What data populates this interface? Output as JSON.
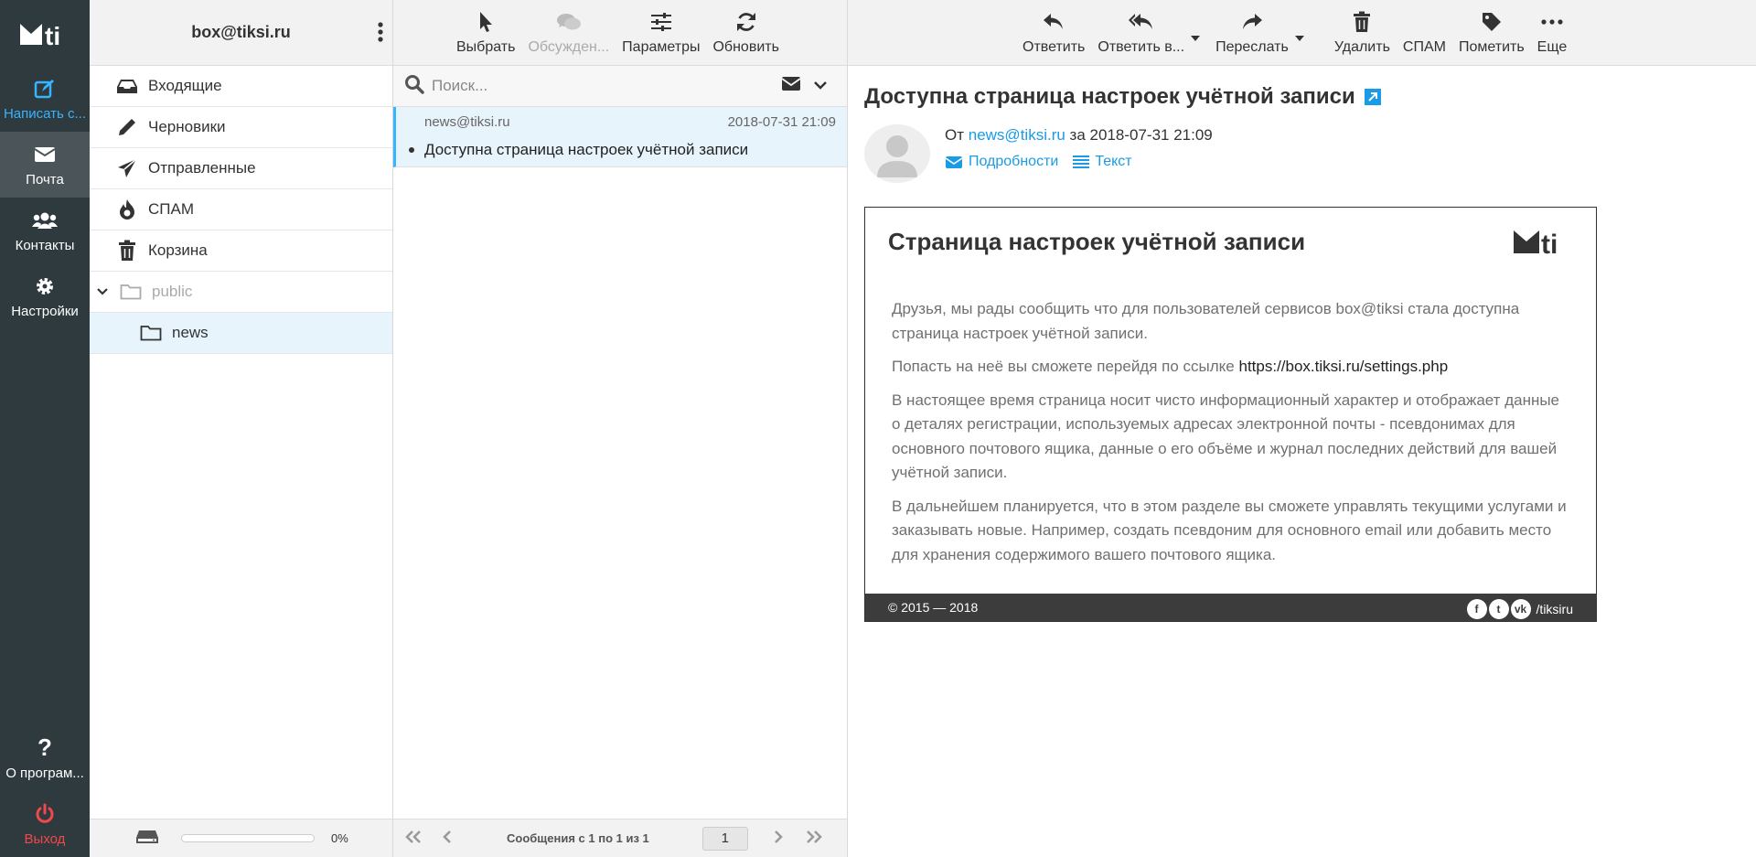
{
  "nav": {
    "items": [
      {
        "label": "Написать с...",
        "icon": "compose-icon"
      },
      {
        "label": "Почта",
        "icon": "envelope-icon"
      },
      {
        "label": "Контакты",
        "icon": "contacts-icon"
      },
      {
        "label": "Настройки",
        "icon": "gear-icon"
      }
    ],
    "bottom": [
      {
        "label": "О програм...",
        "icon": "help-icon"
      },
      {
        "label": "Выход",
        "icon": "power-icon"
      }
    ]
  },
  "account": {
    "email": "box@tiksi.ru"
  },
  "folders": [
    {
      "label": "Входящие",
      "icon": "inbox-icon"
    },
    {
      "label": "Черновики",
      "icon": "pencil-icon"
    },
    {
      "label": "Отправленные",
      "icon": "send-icon"
    },
    {
      "label": "СПАМ",
      "icon": "fire-icon"
    },
    {
      "label": "Корзина",
      "icon": "trash-icon"
    },
    {
      "label": "public",
      "icon": "folder-icon"
    },
    {
      "label": "news",
      "icon": "folder-icon"
    }
  ],
  "quota": {
    "percent_label": "0%",
    "fraction": 0.0
  },
  "list_toolbar": {
    "select": "Выбрать",
    "threads": "Обсужден...",
    "options": "Параметры",
    "refresh": "Обновить"
  },
  "search": {
    "placeholder": "Поиск..."
  },
  "messages": [
    {
      "from": "news@tiksi.ru",
      "date": "2018-07-31 21:09",
      "subject": "Доступна страница настроек учётной записи"
    }
  ],
  "pager": {
    "summary": "Сообщения с 1 по 1 из 1",
    "page": "1"
  },
  "viewer_toolbar": {
    "reply": "Ответить",
    "reply_all": "Ответить в...",
    "forward": "Переслать",
    "delete": "Удалить",
    "spam": "СПАМ",
    "mark": "Пометить",
    "more": "Еще"
  },
  "message": {
    "title": "Доступна страница настроек учётной записи",
    "from_prefix": "От",
    "from": "news@tiksi.ru",
    "date_prefix": "за",
    "date": "2018-07-31 21:09",
    "details_link": "Подробности",
    "text_link": "Текст"
  },
  "email": {
    "title": "Страница настроек учётной записи",
    "p1": "Друзья, мы рады сообщить что для пользователей сервисов box@tiksi стала доступна страница настроек учётной записи.",
    "p2_prefix": "Попасть на неё вы сможете перейдя по ссылке",
    "p2_url": "https://box.tiksi.ru/settings.php",
    "p3": "В настоящее время страница носит чисто информационный характер и отображает данные о деталях регистрации, используемых адресах электронной почты - псевдонимах для основного почтового ящика, данные о его объёме и журнал последних действий для вашей учётной записи.",
    "p4": "В дальнейшем планируется, что в этом разделе вы сможете управлять текущими услугами и заказывать новые. Например, создать псевдоним для основного email или добавить место для хранения содержимого вашего почтового ящика.",
    "footer_copy": "© 2015 — 2018",
    "social_handle": "/tiksiru"
  },
  "colors": {
    "accent": "#37b3ff",
    "link": "#1a9be5",
    "nav_bg": "#2f3a3f",
    "logout": "#f0484b"
  }
}
